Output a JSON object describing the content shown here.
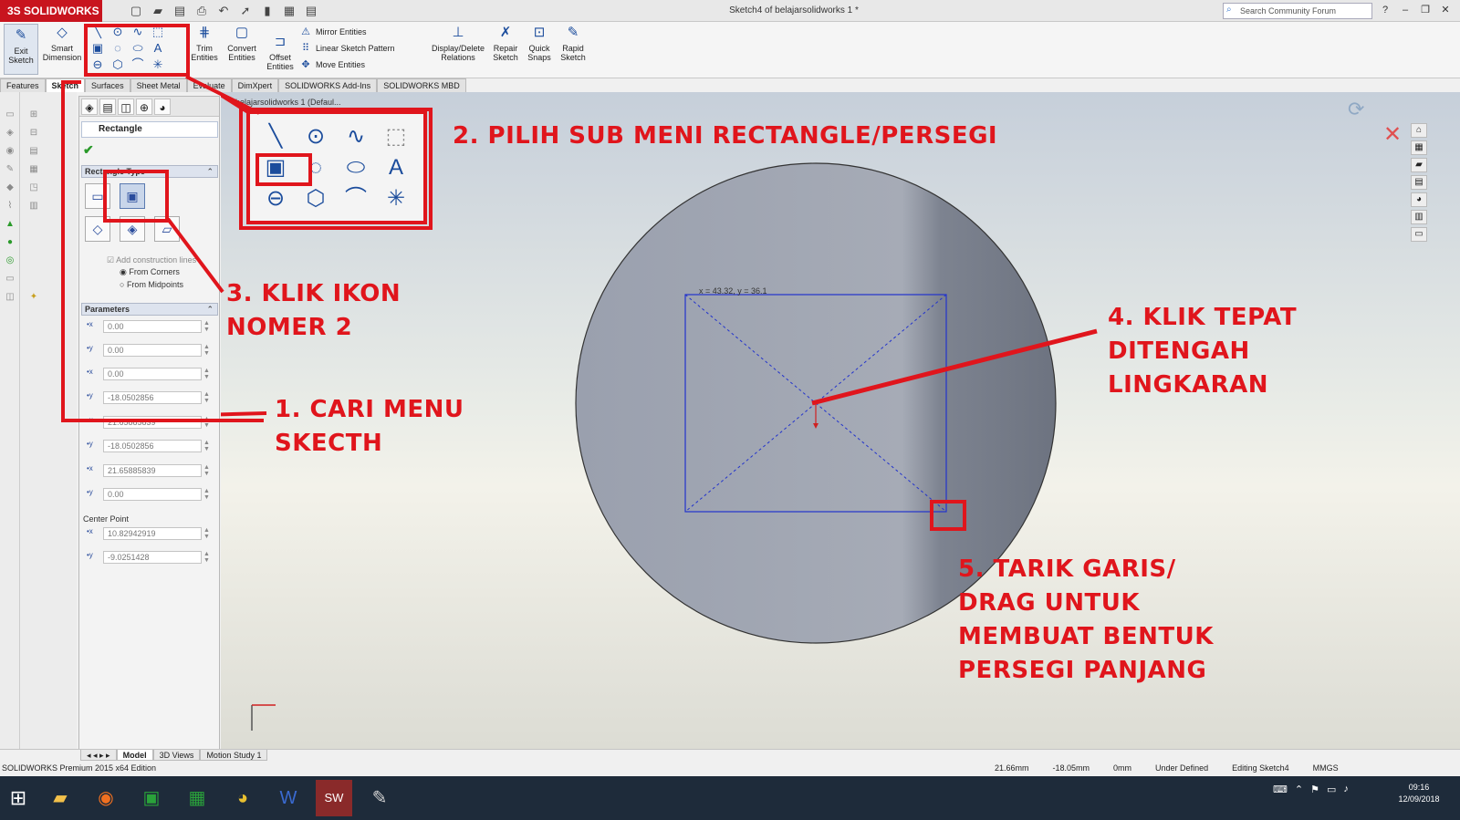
{
  "app": {
    "logo": "3S SOLIDWORKS",
    "doc_title": "Sketch4 of belajarsolidworks 1 *",
    "search_placeholder": "Search Community Forum"
  },
  "ribbon": {
    "exit_sketch": "Exit Sketch",
    "smart_dimension": "Smart Dimension",
    "trim_entities": "Trim Entities",
    "convert_entities": "Convert Entities",
    "offset_entities": "Offset Entities",
    "mirror_entities": "Mirror Entities",
    "linear_sketch_pattern": "Linear Sketch Pattern",
    "move_entities": "Move Entities",
    "display_delete_relations": "Display/Delete Relations",
    "repair_sketch": "Repair Sketch",
    "quick_snaps": "Quick Snaps",
    "rapid_sketch": "Rapid Sketch"
  },
  "tabs": [
    "Features",
    "Sketch",
    "Surfaces",
    "Sheet Metal",
    "Evaluate",
    "DimXpert",
    "SOLIDWORKS Add-Ins",
    "SOLIDWORKS MBD"
  ],
  "property_manager": {
    "title": "Rectangle",
    "rect_type_header": "Rectangle Type",
    "add_construction_lines": "Add construction lines",
    "from_corners": "From Corners",
    "from_midpoints": "From Midpoints",
    "parameters_header": "Parameters",
    "params": [
      "0.00",
      "0.00",
      "0.00",
      "-18.0502856",
      "21.65885839",
      "-18.0502856",
      "21.65885839",
      "0.00"
    ],
    "center_point_label": "Center Point",
    "center_point": [
      "10.82942919",
      "-9.0251428"
    ]
  },
  "graphics": {
    "tree_title": "belajarsolidworks 1 (Defaul...",
    "coord_readout": "x = 43.32, y = 36.1"
  },
  "model_tabs": [
    "Model",
    "3D Views",
    "Motion Study 1"
  ],
  "status": {
    "edition": "SOLIDWORKS Premium 2015 x64 Edition",
    "x": "21.66mm",
    "y": "-18.05mm",
    "z": "0mm",
    "state": "Under Defined",
    "editing": "Editing Sketch4",
    "units": "MMGS"
  },
  "taskbar": {
    "time": "09:16",
    "date": "12/09/2018"
  },
  "annotations": {
    "step1": [
      "1. CARI MENU",
      "SKECTH"
    ],
    "step2": "2. PILIH SUB MENI RECTANGLE/PERSEGI",
    "step3": [
      "3. KLIK IKON",
      "NOMER 2"
    ],
    "step4": [
      "4. KLIK TEPAT",
      "DITENGAH",
      "LINGKARAN"
    ],
    "step5": [
      "5. TARIK GARIS/",
      "DRAG UNTUK",
      "MEMBUAT BENTUK",
      "PERSEGI PANJANG"
    ]
  },
  "colors": {
    "annotation": "#e0151c",
    "sketch_line": "#2233cc",
    "disc": "#8f95a6"
  }
}
